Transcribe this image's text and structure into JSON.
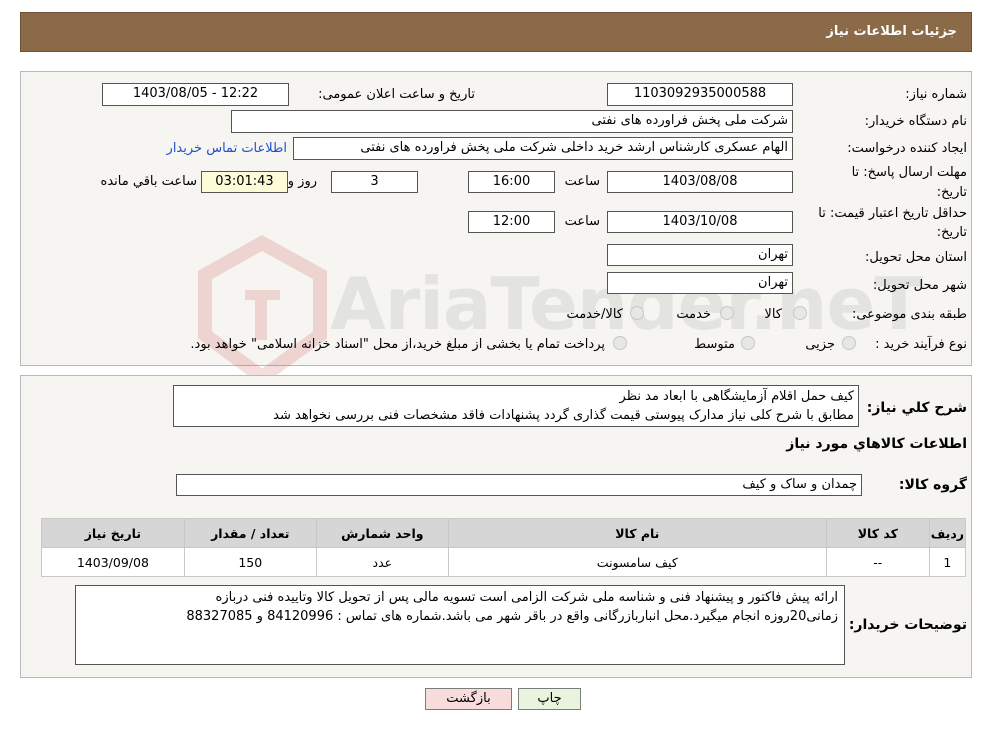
{
  "header": {
    "title": "جزئیات اطلاعات نیاز"
  },
  "fields": {
    "need_number_label": "شماره نیاز:",
    "need_number": "1103092935000588",
    "announce_label": "تاریخ و ساعت اعلان عمومی:",
    "announce_value": "1403/08/05 - 12:22",
    "buyer_org_label": "نام دستگاه خریدار:",
    "buyer_org": "شرکت ملی پخش فراورده های نفتی",
    "creator_label": "ایجاد کننده درخواست:",
    "creator": "الهام عسکری کارشناس ارشد خرید داخلی شرکت ملی پخش فراورده های نفتی",
    "contact_link": "اطلاعات تماس خریدار",
    "deadline_label_1": "مهلت ارسال پاسخ: تا",
    "deadline_label_2": "تاریخ:",
    "deadline_date": "1403/08/08",
    "time_label": "ساعت",
    "deadline_time": "16:00",
    "days_value": "3",
    "days_label": "روز و",
    "remaining_time": "03:01:43",
    "remaining_label": "ساعت باقي مانده",
    "price_label_1": "حداقل تاریخ اعتبار قیمت: تا",
    "price_label_2": "تاریخ:",
    "price_date": "1403/10/08",
    "price_time": "12:00",
    "province_label": "استان محل تحویل:",
    "province": "تهران",
    "city_label": "شهر محل تحویل:",
    "city": "تهران",
    "category_label": "طبقه بندی موضوعی:",
    "category_options": [
      "کالا",
      "خدمت",
      "کالا/خدمت"
    ],
    "process_label": "نوع فرآیند خرید :",
    "process_options": [
      "جزیی",
      "متوسط"
    ],
    "process_note": "پرداخت تمام یا بخشی از مبلغ خرید،از محل \"اسناد خزانه اسلامی\" خواهد بود."
  },
  "description": {
    "label": "شرح کلي نیاز:",
    "line1": "کیف حمل اقلام آزمایشگاهی با ابعاد مد نظر",
    "line2": "مطابق با شرح کلی نیاز مدارک پیوستی قیمت گذاری گردد پشنهادات فاقد مشخصات فنی بررسی نخواهد شد"
  },
  "goods": {
    "section_title": "اطلاعات کالاهاي مورد نیاز",
    "group_label": "گروه کالا:",
    "group_value": "چمدان و ساک و کیف",
    "columns": [
      "رديف",
      "کد کالا",
      "نام کالا",
      "واحد شمارش",
      "تعداد / مقدار",
      "تاریخ نیاز"
    ],
    "rows": [
      [
        "1",
        "--",
        "کیف سامسونت",
        "عدد",
        "150",
        "1403/09/08"
      ]
    ]
  },
  "buyer_notes": {
    "label": "توضیحات خریدار:",
    "line1": "ارائه پیش فاکتور و پیشنهاد فنی و شناسه ملی شرکت الزامی است تسویه مالی پس از تحویل کالا وتاییده فنی دربازه",
    "line2": "زمانی20روزه انجام میگیرد.محل انبارباز‌رگانی واقع در باقر شهر می باشد.شماره های تماس : 84120996 و 88327085"
  },
  "buttons": {
    "print": "چاپ",
    "back": "بازگشت"
  },
  "watermark": {
    "text": "AriaTender.neT"
  },
  "colors": {
    "header_bg": "#8b6a48",
    "link": "#2050d0",
    "back_button": "#f8dcdc",
    "print_button": "#e8f4dd"
  }
}
